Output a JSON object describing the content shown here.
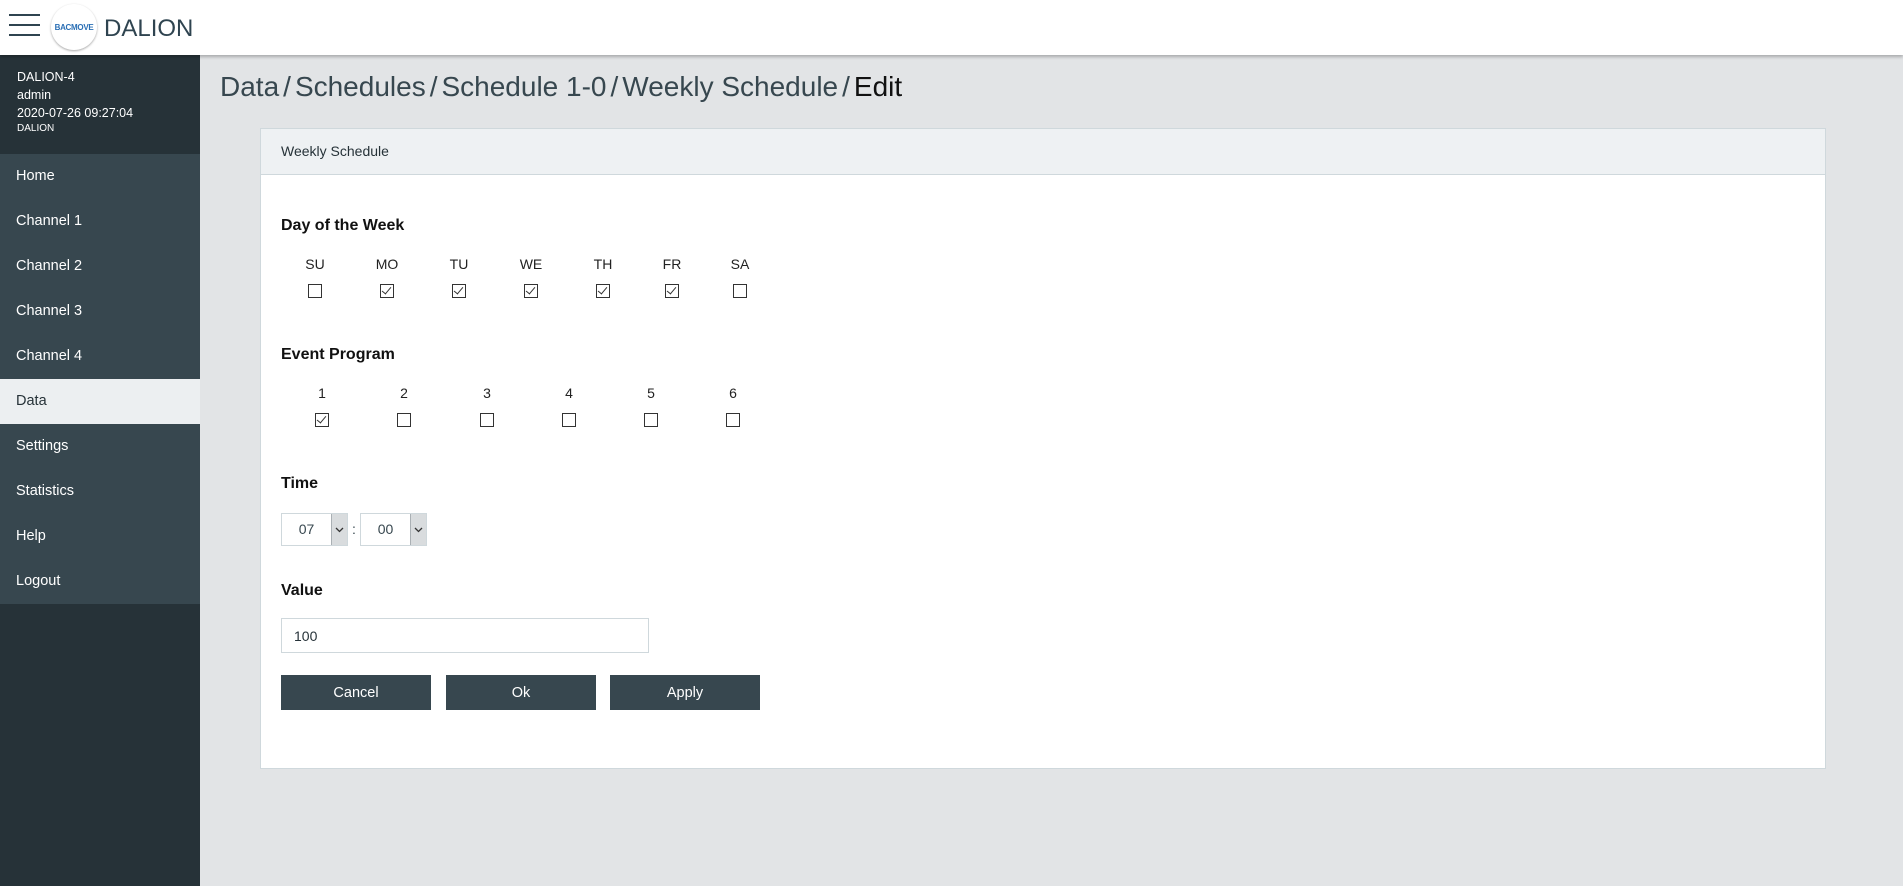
{
  "app": {
    "title": "DALION",
    "logo_text": "BACMOVE"
  },
  "user": {
    "device": "DALION-4",
    "username": "admin",
    "datetime": "2020-07-26 09:27:04",
    "product": "DALION"
  },
  "sidebar": {
    "items": [
      {
        "label": "Home"
      },
      {
        "label": "Channel 1"
      },
      {
        "label": "Channel 2"
      },
      {
        "label": "Channel 3"
      },
      {
        "label": "Channel 4"
      },
      {
        "label": "Data"
      },
      {
        "label": "Settings"
      },
      {
        "label": "Statistics"
      },
      {
        "label": "Help"
      },
      {
        "label": "Logout"
      }
    ],
    "active": "Data"
  },
  "breadcrumb": {
    "items": [
      "Data",
      "Schedules",
      "Schedule 1-0",
      "Weekly Schedule"
    ],
    "current": "Edit",
    "separator": "/"
  },
  "panel": {
    "title": "Weekly Schedule"
  },
  "days": {
    "title": "Day of the Week",
    "items": [
      {
        "label": "SU",
        "checked": false
      },
      {
        "label": "MO",
        "checked": true
      },
      {
        "label": "TU",
        "checked": true
      },
      {
        "label": "WE",
        "checked": true
      },
      {
        "label": "TH",
        "checked": true
      },
      {
        "label": "FR",
        "checked": true
      },
      {
        "label": "SA",
        "checked": false
      }
    ]
  },
  "event_program": {
    "title": "Event Program",
    "items": [
      {
        "label": "1",
        "checked": true
      },
      {
        "label": "2",
        "checked": false
      },
      {
        "label": "3",
        "checked": false
      },
      {
        "label": "4",
        "checked": false
      },
      {
        "label": "5",
        "checked": false
      },
      {
        "label": "6",
        "checked": false
      }
    ]
  },
  "time": {
    "title": "Time",
    "hour": "07",
    "minute": "00",
    "separator": ":"
  },
  "value": {
    "title": "Value",
    "current": "100"
  },
  "buttons": {
    "cancel": "Cancel",
    "ok": "Ok",
    "apply": "Apply"
  },
  "colors": {
    "sidebar_bg": "#263238",
    "nav_bg": "#37474f",
    "button_bg": "#37474f",
    "page_bg": "#e2e4e6",
    "brand": "#2a6fb5"
  }
}
